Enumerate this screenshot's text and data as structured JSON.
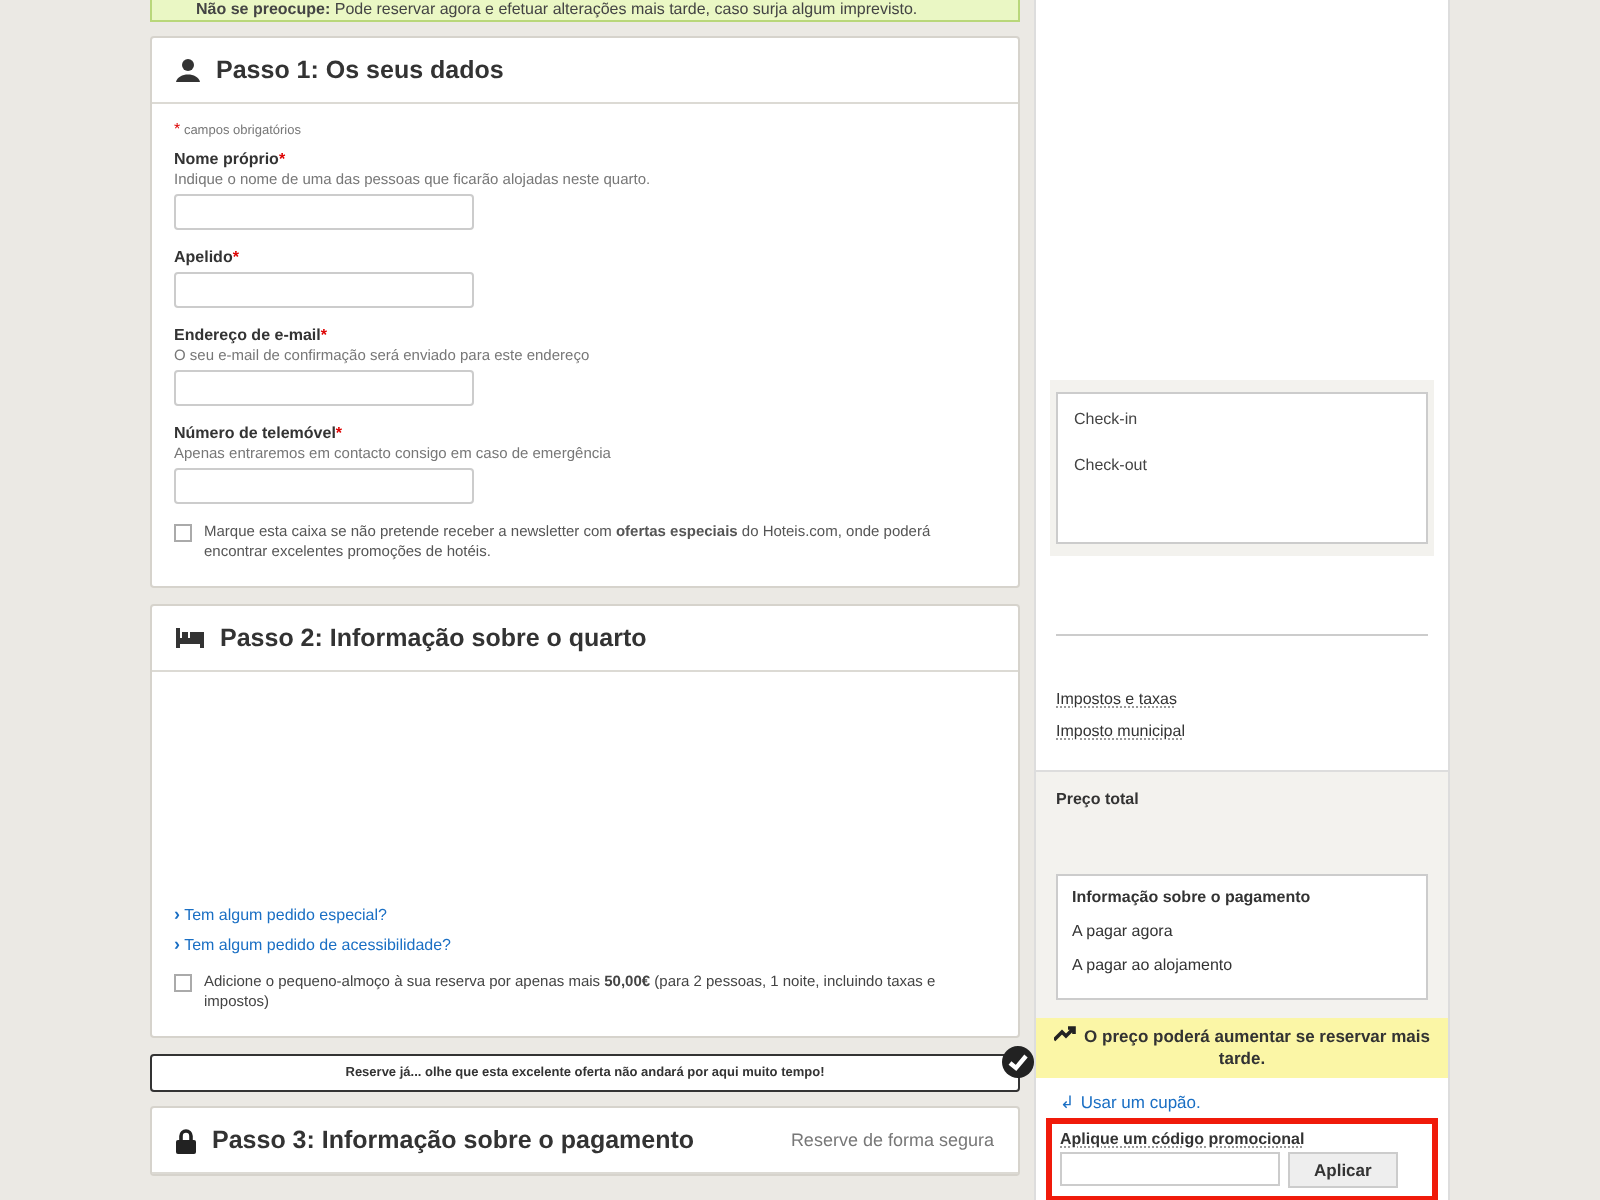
{
  "notice": {
    "text": "**Não se preocupe:** Pode reservar agora e efetuar alterações mais tarde, caso surja algum imprevisto."
  },
  "step1": {
    "title": "Passo 1: Os seus dados",
    "legend": {
      "mark": "*",
      "text": "campos obrigatórios"
    },
    "fields": [
      {
        "label": "Nome próprio",
        "mark": "*",
        "hint": "Indique o nome de uma das pessoas que ficarão alojadas neste quarto."
      },
      {
        "label": "Apelido",
        "mark": "*"
      },
      {
        "label": "Endereço de e-mail",
        "mark": "*",
        "hint": "O seu e-mail de confirmação será enviado para este endereço"
      },
      {
        "label": "Número de telemóvel",
        "mark": "*",
        "hint": "Apenas entraremos em contacto consigo em caso de emergência"
      }
    ],
    "newsletter": {
      "checked": false,
      "text": "Marque esta caixa se não pretende receber a newsletter com **ofertas especiais** do Hoteis.com, onde poderá encontrar excelentes promoções de hotéis."
    }
  },
  "step2": {
    "title": "Passo 2: Informação sobre o quarto",
    "links": [
      {
        "icon": "›",
        "text": "Tem algum pedido especial?"
      },
      {
        "icon": "›",
        "text": "Tem algum pedido de acessibilidade?"
      }
    ],
    "breakfast": {
      "checked": false,
      "text": "Adicione o pequeno-almoço à sua reserva por apenas mais **50,00€** (para 2 pessoas, 1 noite, incluindo taxas e impostos)"
    }
  },
  "reserve_bar": {
    "text": "Reserve já... olhe que esta excelente oferta não andará por aqui muito tempo!",
    "checked": true
  },
  "step3": {
    "title": "Passo 3: Informação sobre o pagamento",
    "secure": "Reserve de forma segura"
  },
  "sidebar": {
    "dates": [
      "Check-in",
      "Check-out"
    ],
    "tax_links": [
      "Impostos e taxas",
      "Imposto municipal"
    ],
    "total_label": "Preço total",
    "payment": {
      "title": "Informação sobre o pagamento",
      "rows": [
        "A pagar agora",
        "A pagar ao alojamento"
      ]
    },
    "price_alert": "O preço poderá aumentar se reservar mais tarde.",
    "coupon_link": {
      "icon": "↲",
      "text": "Usar um cupão."
    },
    "promo": {
      "label": "Aplique um código promocional",
      "button": "Aplicar",
      "highlighted": true
    }
  }
}
